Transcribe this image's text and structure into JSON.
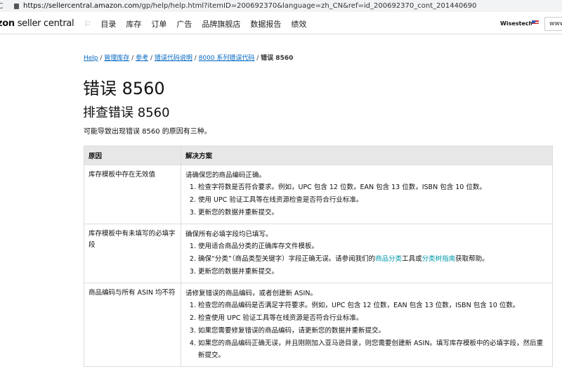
{
  "browser": {
    "url_host": "https://sellercentral.amazon.com",
    "url_path": "/gp/help/help.html?itemID=200692370&language=zh_CN&ref=id_200692370_cont_201440690"
  },
  "nav": {
    "logo_bold": "zon",
    "logo_rest": " seller central",
    "menu": [
      "目录",
      "库存",
      "订单",
      "广告",
      "品牌旗舰店",
      "数据报告",
      "绩效"
    ],
    "user": "Wisestech",
    "search_value": "www."
  },
  "breadcrumb": {
    "items": [
      "Help",
      "管理库存",
      "参考",
      "错误代码说明",
      "8000 系列错误代码"
    ],
    "current": "错误 8560",
    "sep": " / "
  },
  "page": {
    "title": "错误 8560",
    "subtitle": "排查错误 8560",
    "intro": "可能导致出现错误 8560 的原因有三种。"
  },
  "table": {
    "headers": [
      "原因",
      "解决方案"
    ],
    "rows": [
      {
        "cause": "库存模板中存在无效值",
        "lead": "请确保您的商品编码正确。",
        "steps": [
          "检查字符数是否符合要求。例如，UPC 包含 12 位数，EAN 包含 13 位数，ISBN 包含 10 位数。",
          "使用 UPC 验证工具等在线资源检查是否符合行业标准。",
          "更新您的数据并重新提交。"
        ]
      },
      {
        "cause": "库存模板中有未填写的必填字段",
        "lead": "确保所有必填字段均已填写。",
        "steps": [
          "使用适合商品分类的正确库存文件模板。",
          "__links__",
          "更新您的数据并重新提交。"
        ],
        "step2_parts": {
          "a": "确保“分类”（商品类型关键字）字段正确无误。请参阅我们的",
          "link1": "商品分类",
          "b": "工具或",
          "link2": "分类树指南",
          "c": "获取帮助。"
        }
      },
      {
        "cause": "商品编码与所有 ASIN 均不符",
        "lead": "请修复错误的商品编码，或者创建新 ASIN。",
        "steps": [
          "检查您的商品编码是否满足字符要求。例如，UPC 包含 12 位数，EAN 包含 13 位数，ISBN 包含 10 位数。",
          "检查使用 UPC 验证工具等在线资源是否符合行业标准。",
          "如果您需要修复错误的商品编码，请更新您的数据并重新提交。",
          "如果您的商品编码正确无误，并且刚刚加入亚马逊目录，则您需要创建新 ASIN。填写库存模板中的必填字段，然后重新提交。"
        ]
      }
    ]
  }
}
